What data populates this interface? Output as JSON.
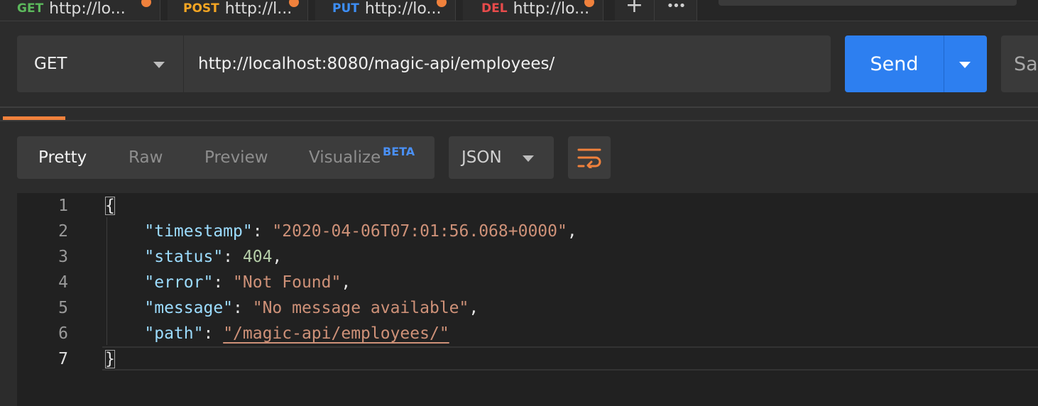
{
  "tabs": [
    {
      "method": "GET",
      "url": "http://lo...",
      "method_color": "#5cb85c",
      "has_changes": true
    },
    {
      "method": "POST",
      "url": "http://l...",
      "method_color": "#f5a623",
      "has_changes": true
    },
    {
      "method": "PUT",
      "url": "http://lo...",
      "method_color": "#3d8ef5",
      "has_changes": true
    },
    {
      "method": "DEL",
      "url": "http://lo...",
      "method_color": "#e84b4b",
      "has_changes": true
    }
  ],
  "tab_actions": {
    "add_icon": "plus-icon",
    "more_icon": "more-icon",
    "add_label": "+",
    "more_label": "•••"
  },
  "request": {
    "method": "GET",
    "url": "http://localhost:8080/magic-api/employees/",
    "send_label": "Send",
    "save_label": "Save"
  },
  "response": {
    "view_tabs": [
      {
        "label": "Pretty",
        "active": true
      },
      {
        "label": "Raw",
        "active": false
      },
      {
        "label": "Preview",
        "active": false
      },
      {
        "label": "Visualize",
        "active": false,
        "badge": "BETA"
      }
    ],
    "format": "JSON",
    "wrap_icon": "wrap-lines-icon",
    "body": {
      "line_numbers": [
        "1",
        "2",
        "3",
        "4",
        "5",
        "6",
        "7"
      ],
      "open_brace": "{",
      "close_brace": "}",
      "fields": [
        {
          "key": "\"timestamp\"",
          "value": "\"2020-04-06T07:01:56.068+0000\"",
          "type": "string",
          "comma": true
        },
        {
          "key": "\"status\"",
          "value": "404",
          "type": "number",
          "comma": true
        },
        {
          "key": "\"error\"",
          "value": "\"Not Found\"",
          "type": "string",
          "comma": true
        },
        {
          "key": "\"message\"",
          "value": "\"No message available\"",
          "type": "string",
          "comma": true
        },
        {
          "key": "\"path\"",
          "value": "\"/magic-api/employees/\"",
          "type": "link",
          "comma": false
        }
      ]
    }
  },
  "colors": {
    "accent_orange": "#f0813c",
    "send_blue": "#2d7ff0",
    "json_key": "#9cdcfe",
    "json_string": "#ce9178",
    "json_number": "#b5cea8"
  }
}
